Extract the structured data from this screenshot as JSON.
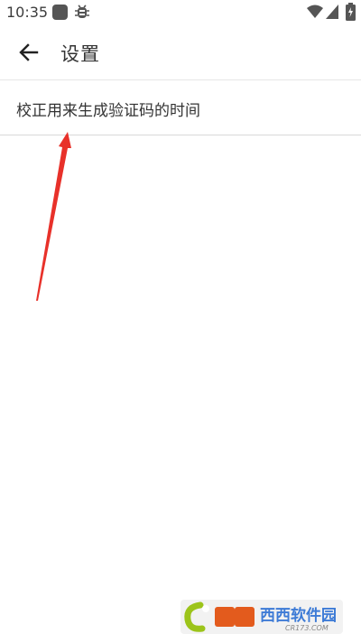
{
  "status_bar": {
    "time": "10:35",
    "icons": [
      "app-square-icon",
      "bug-icon",
      "wifi-icon",
      "signal-icon",
      "battery-icon"
    ]
  },
  "app_bar": {
    "back_icon": "arrow-left-icon",
    "title": "设置"
  },
  "settings": {
    "items": [
      {
        "label": "校正用来生成验证码的时间"
      }
    ]
  },
  "annotation": {
    "arrow_color": "#e8312a"
  },
  "watermark": {
    "brand": "西西软件园",
    "url": "CR173.COM"
  },
  "colors": {
    "background": "#ffffff",
    "text_primary": "#333333",
    "divider": "#d9d9d9",
    "annotation": "#e8312a"
  }
}
